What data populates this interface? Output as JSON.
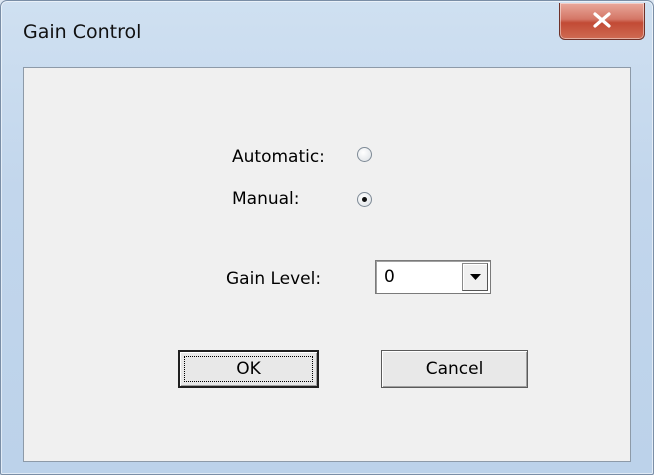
{
  "window": {
    "title": "Gain Control"
  },
  "mode": {
    "automatic_label": "Automatic:",
    "manual_label": "Manual:",
    "selected": "manual"
  },
  "gain": {
    "label": "Gain Level:",
    "value": "0"
  },
  "buttons": {
    "ok": "OK",
    "cancel": "Cancel"
  },
  "icons": {
    "close": "close-icon",
    "dropdown": "chevron-down-icon"
  },
  "colors": {
    "close_button": "#c24a35",
    "client_bg": "#f0f0f0",
    "frame": "#c2d6ec"
  }
}
